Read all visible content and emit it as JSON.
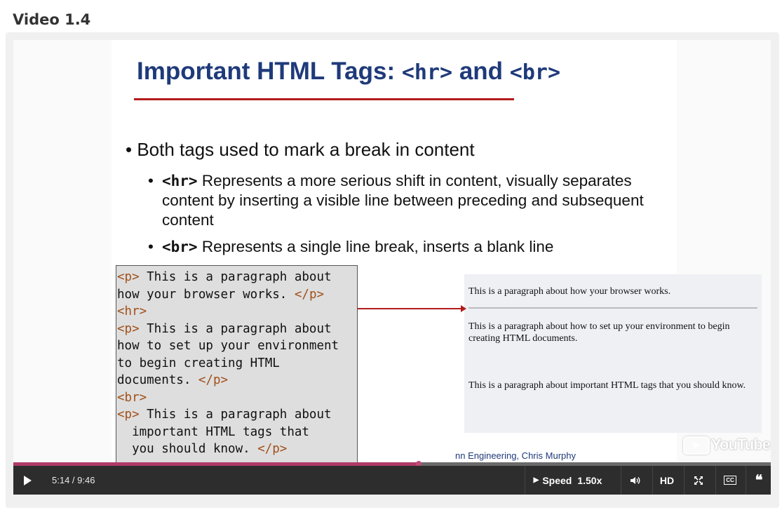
{
  "heading": "Video 1.4",
  "slide": {
    "title_pre": "Important HTML Tags: ",
    "title_code1": "<hr>",
    "title_mid": " and ",
    "title_code2": "<br>",
    "bullet_main": "Both tags used to mark a break in content",
    "bullet_hr_code": "<hr>",
    "bullet_hr_text": "  Represents a more serious shift in content, visually separates content by inserting a visible line between preceding and subsequent content",
    "bullet_br_code": "<br>",
    "bullet_br_text": " Represents a single line break, inserts a blank line",
    "code_lines": [
      {
        "tag1": "<p>",
        "text": " This is a paragraph about",
        "tag2": ""
      },
      {
        "tag1": "",
        "text": "how your browser works. ",
        "tag2": "</p>"
      },
      {
        "tag1": "<hr>",
        "text": "",
        "tag2": ""
      },
      {
        "tag1": "<p>",
        "text": " This is a paragraph about",
        "tag2": ""
      },
      {
        "tag1": "",
        "text": "how to set up your environment",
        "tag2": ""
      },
      {
        "tag1": "",
        "text": "to begin creating HTML",
        "tag2": ""
      },
      {
        "tag1": "",
        "text": "documents. ",
        "tag2": "</p>"
      },
      {
        "tag1": "<br>",
        "text": "",
        "tag2": ""
      },
      {
        "tag1": "<p>",
        "text": " This is a paragraph about",
        "tag2": ""
      },
      {
        "tag1": "",
        "text": "  important HTML tags that",
        "tag2": ""
      },
      {
        "tag1": "",
        "text": "  you should know. ",
        "tag2": "</p>"
      }
    ],
    "browser_p1": "This is a paragraph about how your browser works.",
    "browser_p2": "This is a paragraph about how to set up your environment to begin creating HTML documents.",
    "browser_p3": "This is a paragraph about important HTML tags that you should know.",
    "credit": "nn Engineering, Chris Murphy",
    "youtube_logo": "YouTube"
  },
  "player": {
    "time": "5:14 / 9:46",
    "progress": 0.535,
    "speed_label": "Speed",
    "speed_value": "1.50x",
    "hd_label": "HD",
    "cc_label": "CC",
    "transcript_glyph": "❝",
    "accent_color": "#b03a68"
  }
}
